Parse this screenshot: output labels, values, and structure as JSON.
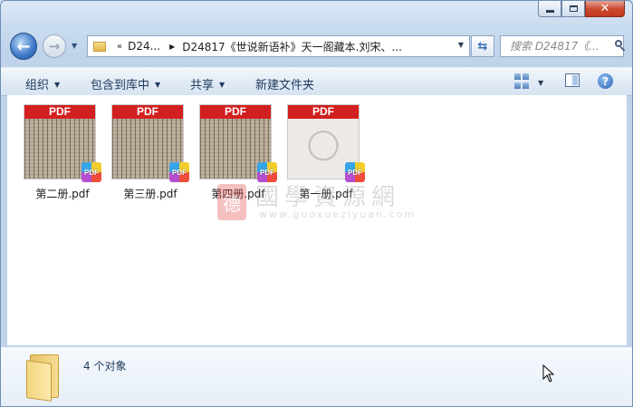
{
  "window": {
    "caption_buttons": [
      "minimize",
      "maximize",
      "close"
    ]
  },
  "nav": {
    "address": {
      "root_chevron": "«",
      "crumb_1": "D24...",
      "crumb_2": "D24817《世说新语补》天一阁藏本.刘宋、..."
    },
    "search_placeholder": "搜索 D24817《..."
  },
  "toolbar": {
    "organize": "组织",
    "include_library": "包含到库中",
    "share": "共享",
    "new_folder": "新建文件夹"
  },
  "files": [
    {
      "name": "第二册.pdf",
      "badge": "PDF",
      "thumb_label": "PDF",
      "thumb_style": "scan"
    },
    {
      "name": "第三册.pdf",
      "badge": "PDF",
      "thumb_label": "PDF",
      "thumb_style": "scan"
    },
    {
      "name": "第四册.pdf",
      "badge": "PDF",
      "thumb_label": "PDF",
      "thumb_style": "scan"
    },
    {
      "name": "第一册.pdf",
      "badge": "PDF",
      "thumb_label": "PDF",
      "thumb_style": "light"
    }
  ],
  "watermark": {
    "seal": "德",
    "title": "國學資源網",
    "url": "www.guoxueziyuan.com"
  },
  "status": {
    "object_count": "4 个对象"
  },
  "colors": {
    "pdf_red": "#d21f1f",
    "window_frame": "#bfd3eb"
  }
}
